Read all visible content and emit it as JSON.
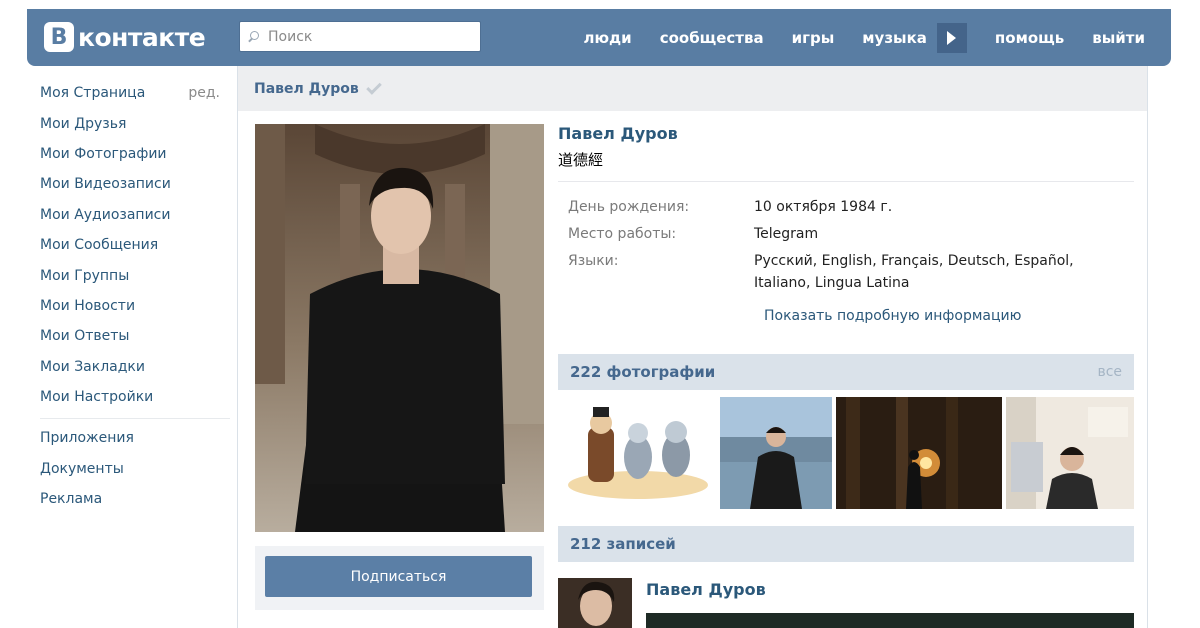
{
  "header": {
    "logo_letter": "В",
    "logo_text": "контакте",
    "search_placeholder": "Поиск",
    "nav": [
      "люди",
      "сообщества",
      "игры",
      "музыка",
      "помощь",
      "выйти"
    ],
    "colors": {
      "header_bg": "#597da3",
      "accent": "#2b587a"
    }
  },
  "sidebar": {
    "items": [
      {
        "label": "Моя Страница",
        "extra": "ред."
      },
      {
        "label": "Мои Друзья"
      },
      {
        "label": "Мои Фотографии"
      },
      {
        "label": "Мои Видеозаписи"
      },
      {
        "label": "Мои Аудиозаписи"
      },
      {
        "label": "Мои Сообщения"
      },
      {
        "label": "Мои Группы"
      },
      {
        "label": "Мои Новости"
      },
      {
        "label": "Мои Ответы"
      },
      {
        "label": "Мои Закладки"
      },
      {
        "label": "Мои Настройки"
      }
    ],
    "extra_items": [
      {
        "label": "Приложения"
      },
      {
        "label": "Документы"
      },
      {
        "label": "Реклама"
      }
    ]
  },
  "page": {
    "title": "Павел Дуров",
    "subscribe_label": "Подписаться"
  },
  "profile": {
    "name": "Павел Дуров",
    "status": "道德經",
    "fields": [
      {
        "label": "День рождения:",
        "value": "10 октября 1984 г."
      },
      {
        "label": "Место работы:",
        "value": "Telegram"
      },
      {
        "label": "Языки:",
        "value": "Русский, English, Français, Deutsch, Español, Italiano, Lingua Latina"
      }
    ],
    "show_more": "Показать подробную информацию"
  },
  "photos": {
    "title": "222 фотографии",
    "all_label": "все"
  },
  "wall": {
    "title": "212 записей",
    "post_author": "Павел Дуров"
  }
}
